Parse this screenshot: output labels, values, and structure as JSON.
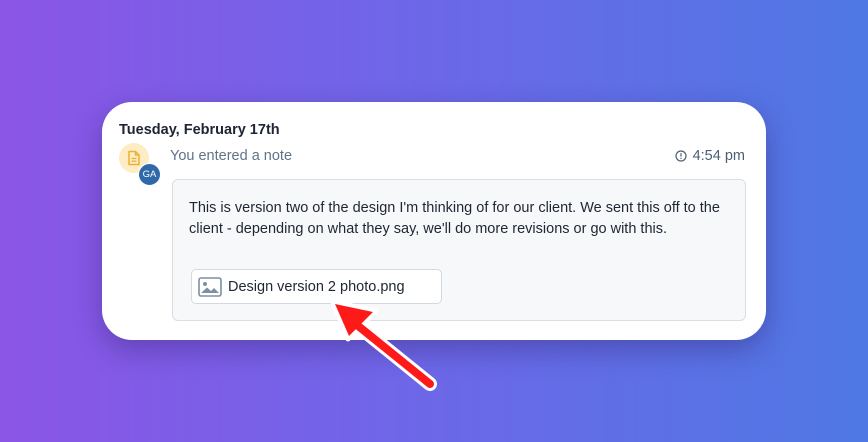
{
  "activity": {
    "date": "Tuesday, February 17th",
    "entry_text": "You entered a note",
    "time": "4:54 pm",
    "avatar_initials": "GA",
    "note_body": "This is version two of the design I'm thinking of for our client. We sent this off to the client - depending on what they say, we'll do more revisions or go with this.",
    "attachment": {
      "name": "Design version 2 photo.png",
      "icon": "image-icon"
    },
    "icons": {
      "entry_type": "note-icon",
      "time": "clock-icon"
    }
  },
  "annotation": {
    "arrow_color": "#ff0000"
  },
  "colors": {
    "note_icon_bg": "#fdecc4",
    "note_icon_fg": "#e9b233",
    "avatar_bg": "#2f69a9"
  }
}
